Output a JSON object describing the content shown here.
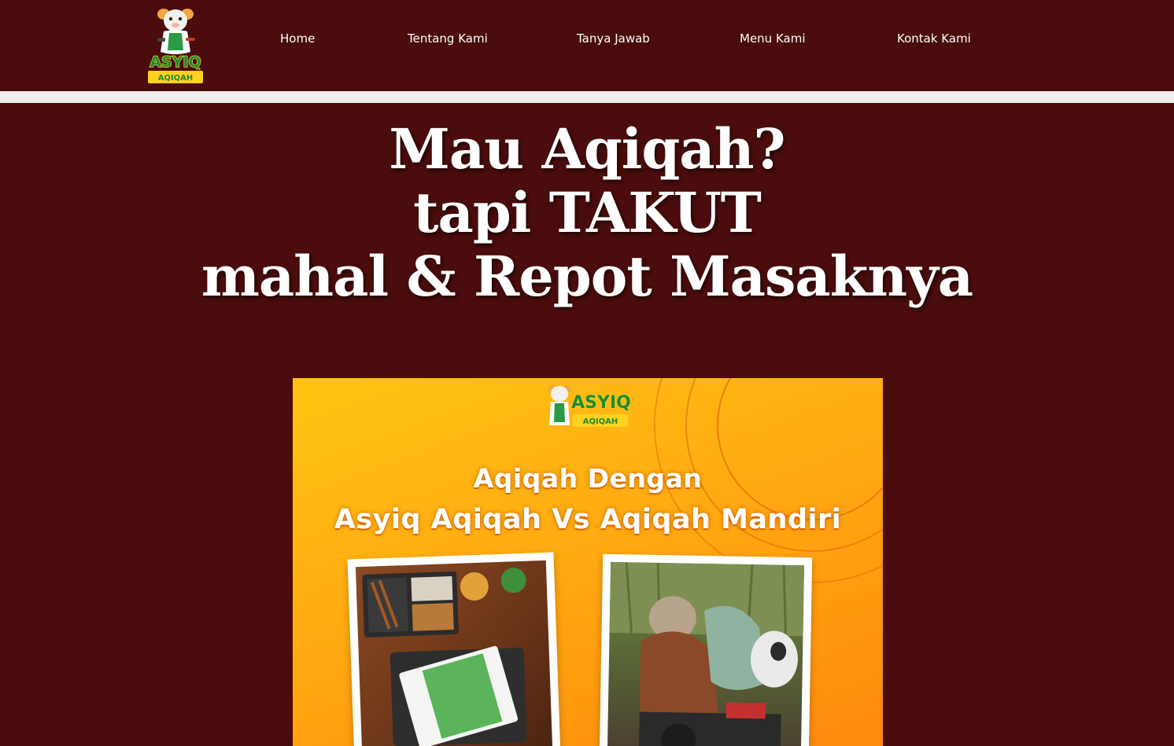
{
  "brand": {
    "name": "ASYIQ",
    "subname": "AQIQAH"
  },
  "nav": {
    "items": [
      {
        "label": "Home"
      },
      {
        "label": "Tentang Kami"
      },
      {
        "label": "Tanya Jawab"
      },
      {
        "label": "Menu Kami"
      },
      {
        "label": "Kontak Kami"
      }
    ]
  },
  "hero": {
    "line1": "Mau Aqiqah?",
    "line2": "tapi TAKUT",
    "line3": "mahal & Repot Masaknya"
  },
  "promo": {
    "logo_name": "ASYIQ",
    "logo_sub": "AQIQAH",
    "title_line1": "Aqiqah Dengan",
    "title_line2": "Asyiq Aqiqah Vs Aqiqah Mandiri"
  },
  "colors": {
    "background": "#4a0c0c",
    "divider": "#efedee",
    "promo_orange": "#ffae12",
    "logo_green": "#1e8a34",
    "logo_yellow": "#ffd21f"
  }
}
